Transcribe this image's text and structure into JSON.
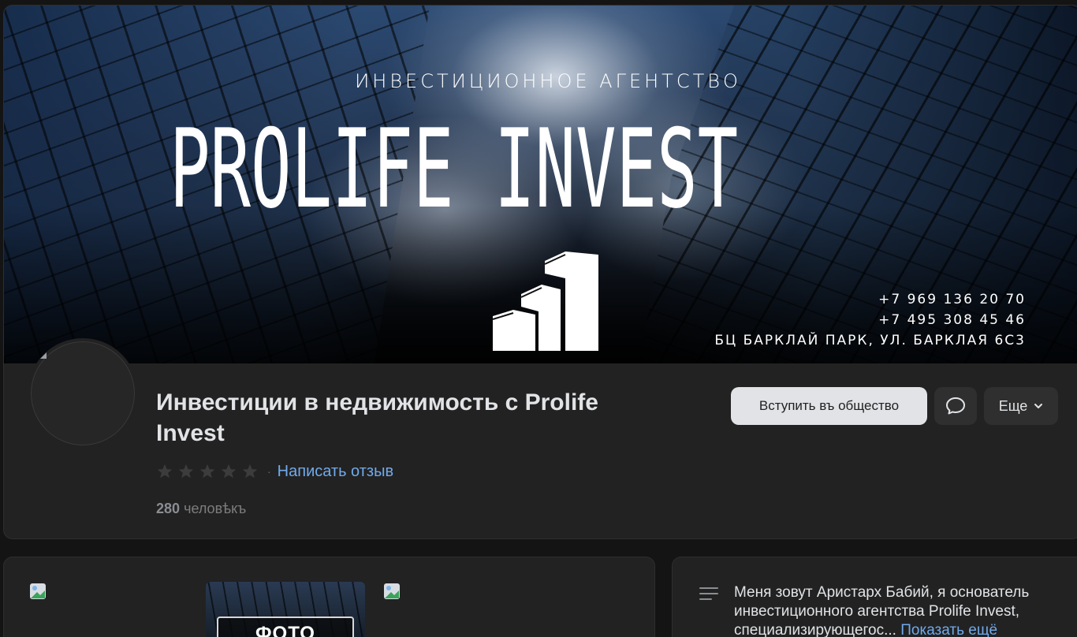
{
  "cover": {
    "subtitle": "ИНВЕСТИЦИОННОЕ АГЕНТСТВО",
    "title": "PROLIFE INVEST",
    "phone_1": "+7 969 136 20 70",
    "phone_2": "+7 495 308 45 46",
    "address": "БЦ БАРКЛАЙ ПАРК, УЛ. БАРКЛАЯ 6С3",
    "logo_icon": "building-chart-logo"
  },
  "group": {
    "name": "Инвестиции в недвижимость с Prolife Invest",
    "rating_stars": 5,
    "rating_value": 0,
    "rating_separator": "·",
    "review_link": "Написать отзыв",
    "members_count": "280",
    "members_label": "человѣкъ"
  },
  "actions": {
    "join_label": "Вступить въ общество",
    "message_icon": "message-bubble-icon",
    "more_label": "Еще"
  },
  "media": {
    "photo_label": "ФОТО"
  },
  "about": {
    "text": "Меня зовут Аристарх Бабий, я основатель инвестиционного агентства Prolife Invest, специализирующегос...",
    "more_link": "Показать ещё"
  },
  "colors": {
    "background": "#141414",
    "card": "#222222",
    "text": "#e1e3e6",
    "muted": "#7d7d7d",
    "link": "#71aaeb",
    "button_primary": "#e1e3e6",
    "button_secondary": "#2f2f2f"
  }
}
